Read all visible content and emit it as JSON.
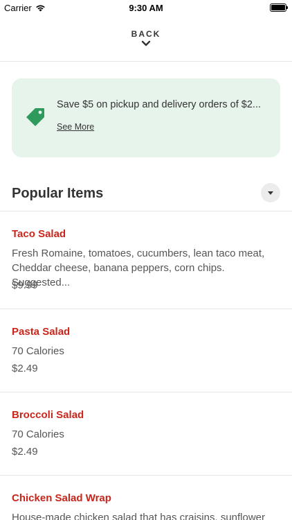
{
  "status_bar": {
    "carrier": "Carrier",
    "time": "9:30 AM",
    "icons": [
      "wifi-icon",
      "battery-icon"
    ]
  },
  "nav": {
    "back_label": "BACK",
    "back_icon": "chevron-down-icon"
  },
  "promo": {
    "text": "Save $5 on pickup and delivery orders of $2...",
    "link": "See More",
    "icon": "tag-icon",
    "background": "#e7f4ec",
    "icon_color": "#2e9b5c"
  },
  "section": {
    "title": "Popular Items",
    "toggle_icon": "caret-down-icon"
  },
  "items": [
    {
      "name": "Taco Salad",
      "description": "Fresh Romaine, tomatoes, cucumbers, lean taco meat, Cheddar cheese, banana peppers, corn chips. Suggested...",
      "price": "$9.99"
    },
    {
      "name": "Pasta Salad",
      "description": "70 Calories",
      "price": "$2.49"
    },
    {
      "name": "Broccoli Salad",
      "description": "70 Calories",
      "price": "$2.49"
    },
    {
      "name": "Chicken Salad Wrap",
      "description": "House-made chicken salad that has craisins, sunflower",
      "price": ""
    }
  ],
  "colors": {
    "item_name": "#c8261b",
    "text": "#333333",
    "secondary_text": "#555555"
  }
}
